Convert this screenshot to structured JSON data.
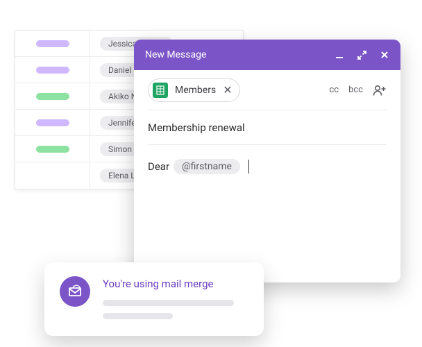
{
  "sheet": {
    "rows": [
      {
        "color": "purple",
        "name": "Jessica Malora"
      },
      {
        "color": "purple",
        "name": "Daniel Ferr"
      },
      {
        "color": "green",
        "name": "Akiko Naka"
      },
      {
        "color": "purple",
        "name": "Jennifer Ac"
      },
      {
        "color": "green",
        "name": "Simon Balli"
      },
      {
        "color": "",
        "name": "Elena Lee"
      }
    ]
  },
  "compose": {
    "title": "New Message",
    "recipient_chip": "Members",
    "cc": "cc",
    "bcc": "bcc",
    "subject": "Membership renewal",
    "body_prefix": "Dear",
    "merge_tag": "@firstname"
  },
  "notice": {
    "title": "You're using mail merge"
  },
  "colors": {
    "brand": "#7b55c7"
  }
}
